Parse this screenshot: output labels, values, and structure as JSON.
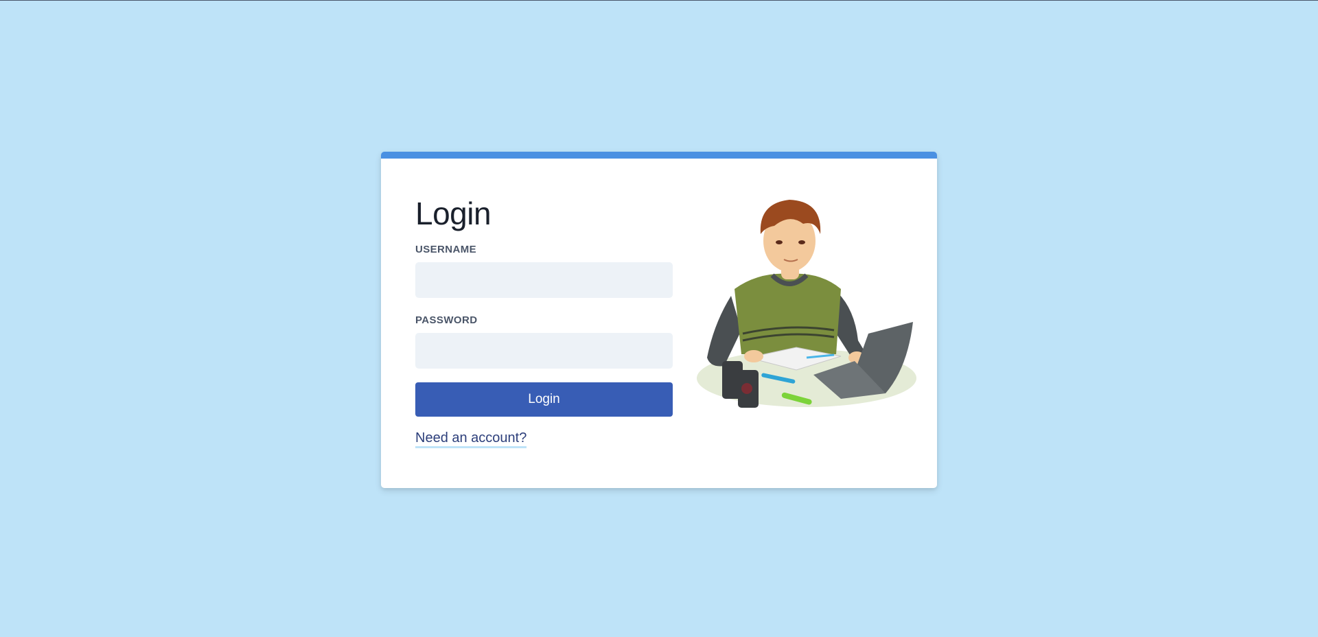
{
  "login": {
    "title": "Login",
    "username_label": "USERNAME",
    "username_value": "",
    "password_label": "PASSWORD",
    "password_value": "",
    "submit_label": "Login",
    "signup_link": "Need an account?"
  },
  "colors": {
    "page_background": "#bee3f8",
    "card_accent": "#4a90e2",
    "button": "#385db5",
    "input_background": "#edf2f7"
  },
  "illustration": {
    "icon": "student-studying-illustration"
  }
}
